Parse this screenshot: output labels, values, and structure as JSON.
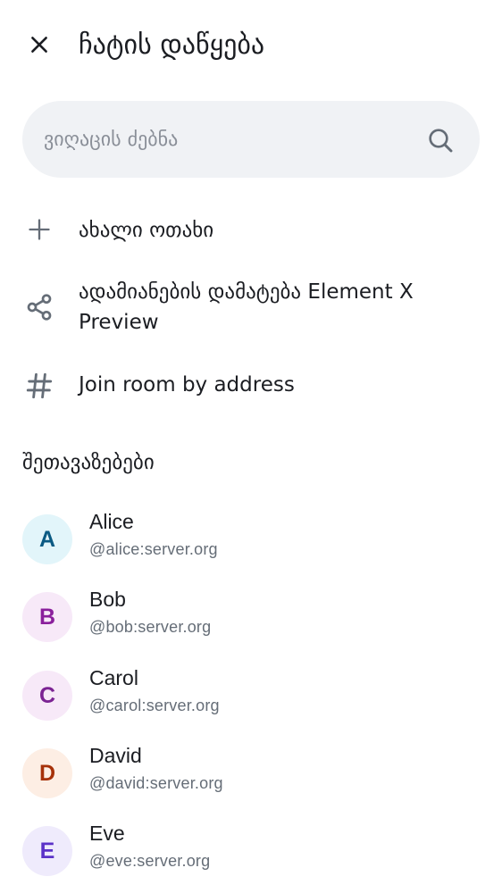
{
  "header": {
    "title": "ჩატის დაწყება",
    "close_icon": "close-icon"
  },
  "search": {
    "placeholder": "ვიღაცის ძებნა",
    "value": "",
    "icon": "search-icon"
  },
  "actions": [
    {
      "label": "ახალი ოთახი",
      "icon": "plus-icon"
    },
    {
      "label": "ადამიანების დამატება Element X Preview",
      "icon": "share-icon"
    },
    {
      "label": "Join room by address",
      "icon": "hash-icon"
    }
  ],
  "suggestions": {
    "title": "შეთავაზებები",
    "users": [
      {
        "initial": "A",
        "name": "Alice",
        "mxid": "@alice:server.org",
        "bg": "#e2f5fa",
        "fg": "#0a5a83"
      },
      {
        "initial": "B",
        "name": "Bob",
        "mxid": "@bob:server.org",
        "bg": "#f7e9f8",
        "fg": "#8a1f9c"
      },
      {
        "initial": "C",
        "name": "Carol",
        "mxid": "@carol:server.org",
        "bg": "#f7e9f8",
        "fg": "#7b2393"
      },
      {
        "initial": "D",
        "name": "David",
        "mxid": "@david:server.org",
        "bg": "#fdeee4",
        "fg": "#a63109"
      },
      {
        "initial": "E",
        "name": "Eve",
        "mxid": "@eve:server.org",
        "bg": "#efebfc",
        "fg": "#5b32c8"
      }
    ]
  }
}
